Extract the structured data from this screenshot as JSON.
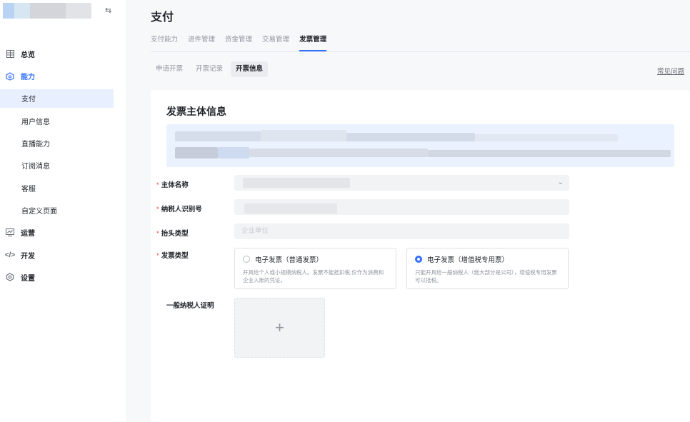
{
  "sidebar": {
    "items": [
      {
        "label": "总览",
        "icon": "grid-icon"
      },
      {
        "label": "能力",
        "icon": "ability-icon"
      },
      {
        "label": "支付"
      },
      {
        "label": "用户信息"
      },
      {
        "label": "直播能力"
      },
      {
        "label": "订阅消息"
      },
      {
        "label": "客服"
      },
      {
        "label": "自定义页面"
      },
      {
        "label": "运营",
        "icon": "operation-icon"
      },
      {
        "label": "开发",
        "icon": "code-icon"
      },
      {
        "label": "设置",
        "icon": "settings-icon"
      }
    ]
  },
  "page": {
    "title": "支付"
  },
  "tabs": [
    "支付能力",
    "进件管理",
    "资金管理",
    "交易管理",
    "发票管理"
  ],
  "subtabs": [
    "申请开票",
    "开票记录",
    "开票信息"
  ],
  "faq": "常见问题",
  "form": {
    "title": "发票主体信息",
    "subject_name_label": "主体名称",
    "taxpayer_id_label": "纳税人识别号",
    "header_type_label": "抬头类型",
    "header_type_placeholder": "企业单位",
    "invoice_type_label": "发票类型",
    "option_normal_title": "电子发票（普通发票）",
    "option_normal_desc": "开具给个人或小规模纳税人。发票不能抵扣税,仅作为消费和企业入账的凭证。",
    "option_special_title": "电子发票（增值税专用票）",
    "option_special_desc": "只能开具给一般纳税人（绝大部分是公司），增值税专用发票可以抵税。",
    "selected_option": "special",
    "certificate_label": "一般纳税人证明",
    "upload_symbol": "+"
  },
  "colors": {
    "accent": "#3370ff",
    "required": "#f54a45",
    "active_bg": "#e8f0ff"
  }
}
